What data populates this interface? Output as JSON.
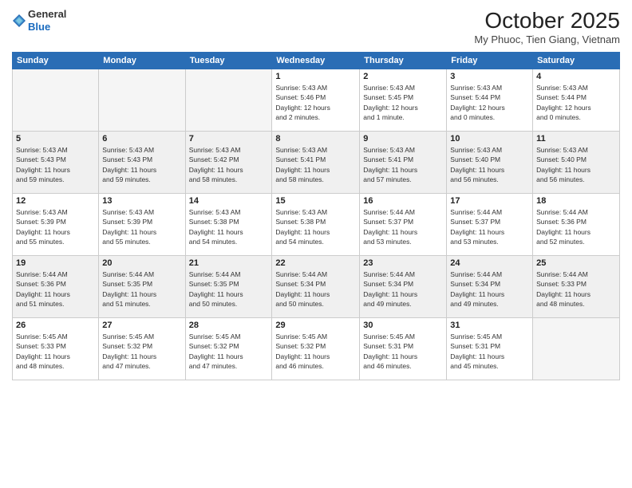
{
  "header": {
    "logo": {
      "line1": "General",
      "line2": "Blue"
    },
    "title": "October 2025",
    "subtitle": "My Phuoc, Tien Giang, Vietnam"
  },
  "weekdays": [
    "Sunday",
    "Monday",
    "Tuesday",
    "Wednesday",
    "Thursday",
    "Friday",
    "Saturday"
  ],
  "weeks": [
    [
      {
        "day": "",
        "info": ""
      },
      {
        "day": "",
        "info": ""
      },
      {
        "day": "",
        "info": ""
      },
      {
        "day": "1",
        "info": "Sunrise: 5:43 AM\nSunset: 5:46 PM\nDaylight: 12 hours\nand 2 minutes."
      },
      {
        "day": "2",
        "info": "Sunrise: 5:43 AM\nSunset: 5:45 PM\nDaylight: 12 hours\nand 1 minute."
      },
      {
        "day": "3",
        "info": "Sunrise: 5:43 AM\nSunset: 5:44 PM\nDaylight: 12 hours\nand 0 minutes."
      },
      {
        "day": "4",
        "info": "Sunrise: 5:43 AM\nSunset: 5:44 PM\nDaylight: 12 hours\nand 0 minutes."
      }
    ],
    [
      {
        "day": "5",
        "info": "Sunrise: 5:43 AM\nSunset: 5:43 PM\nDaylight: 11 hours\nand 59 minutes."
      },
      {
        "day": "6",
        "info": "Sunrise: 5:43 AM\nSunset: 5:43 PM\nDaylight: 11 hours\nand 59 minutes."
      },
      {
        "day": "7",
        "info": "Sunrise: 5:43 AM\nSunset: 5:42 PM\nDaylight: 11 hours\nand 58 minutes."
      },
      {
        "day": "8",
        "info": "Sunrise: 5:43 AM\nSunset: 5:41 PM\nDaylight: 11 hours\nand 58 minutes."
      },
      {
        "day": "9",
        "info": "Sunrise: 5:43 AM\nSunset: 5:41 PM\nDaylight: 11 hours\nand 57 minutes."
      },
      {
        "day": "10",
        "info": "Sunrise: 5:43 AM\nSunset: 5:40 PM\nDaylight: 11 hours\nand 56 minutes."
      },
      {
        "day": "11",
        "info": "Sunrise: 5:43 AM\nSunset: 5:40 PM\nDaylight: 11 hours\nand 56 minutes."
      }
    ],
    [
      {
        "day": "12",
        "info": "Sunrise: 5:43 AM\nSunset: 5:39 PM\nDaylight: 11 hours\nand 55 minutes."
      },
      {
        "day": "13",
        "info": "Sunrise: 5:43 AM\nSunset: 5:39 PM\nDaylight: 11 hours\nand 55 minutes."
      },
      {
        "day": "14",
        "info": "Sunrise: 5:43 AM\nSunset: 5:38 PM\nDaylight: 11 hours\nand 54 minutes."
      },
      {
        "day": "15",
        "info": "Sunrise: 5:43 AM\nSunset: 5:38 PM\nDaylight: 11 hours\nand 54 minutes."
      },
      {
        "day": "16",
        "info": "Sunrise: 5:44 AM\nSunset: 5:37 PM\nDaylight: 11 hours\nand 53 minutes."
      },
      {
        "day": "17",
        "info": "Sunrise: 5:44 AM\nSunset: 5:37 PM\nDaylight: 11 hours\nand 53 minutes."
      },
      {
        "day": "18",
        "info": "Sunrise: 5:44 AM\nSunset: 5:36 PM\nDaylight: 11 hours\nand 52 minutes."
      }
    ],
    [
      {
        "day": "19",
        "info": "Sunrise: 5:44 AM\nSunset: 5:36 PM\nDaylight: 11 hours\nand 51 minutes."
      },
      {
        "day": "20",
        "info": "Sunrise: 5:44 AM\nSunset: 5:35 PM\nDaylight: 11 hours\nand 51 minutes."
      },
      {
        "day": "21",
        "info": "Sunrise: 5:44 AM\nSunset: 5:35 PM\nDaylight: 11 hours\nand 50 minutes."
      },
      {
        "day": "22",
        "info": "Sunrise: 5:44 AM\nSunset: 5:34 PM\nDaylight: 11 hours\nand 50 minutes."
      },
      {
        "day": "23",
        "info": "Sunrise: 5:44 AM\nSunset: 5:34 PM\nDaylight: 11 hours\nand 49 minutes."
      },
      {
        "day": "24",
        "info": "Sunrise: 5:44 AM\nSunset: 5:34 PM\nDaylight: 11 hours\nand 49 minutes."
      },
      {
        "day": "25",
        "info": "Sunrise: 5:44 AM\nSunset: 5:33 PM\nDaylight: 11 hours\nand 48 minutes."
      }
    ],
    [
      {
        "day": "26",
        "info": "Sunrise: 5:45 AM\nSunset: 5:33 PM\nDaylight: 11 hours\nand 48 minutes."
      },
      {
        "day": "27",
        "info": "Sunrise: 5:45 AM\nSunset: 5:32 PM\nDaylight: 11 hours\nand 47 minutes."
      },
      {
        "day": "28",
        "info": "Sunrise: 5:45 AM\nSunset: 5:32 PM\nDaylight: 11 hours\nand 47 minutes."
      },
      {
        "day": "29",
        "info": "Sunrise: 5:45 AM\nSunset: 5:32 PM\nDaylight: 11 hours\nand 46 minutes."
      },
      {
        "day": "30",
        "info": "Sunrise: 5:45 AM\nSunset: 5:31 PM\nDaylight: 11 hours\nand 46 minutes."
      },
      {
        "day": "31",
        "info": "Sunrise: 5:45 AM\nSunset: 5:31 PM\nDaylight: 11 hours\nand 45 minutes."
      },
      {
        "day": "",
        "info": ""
      }
    ]
  ]
}
